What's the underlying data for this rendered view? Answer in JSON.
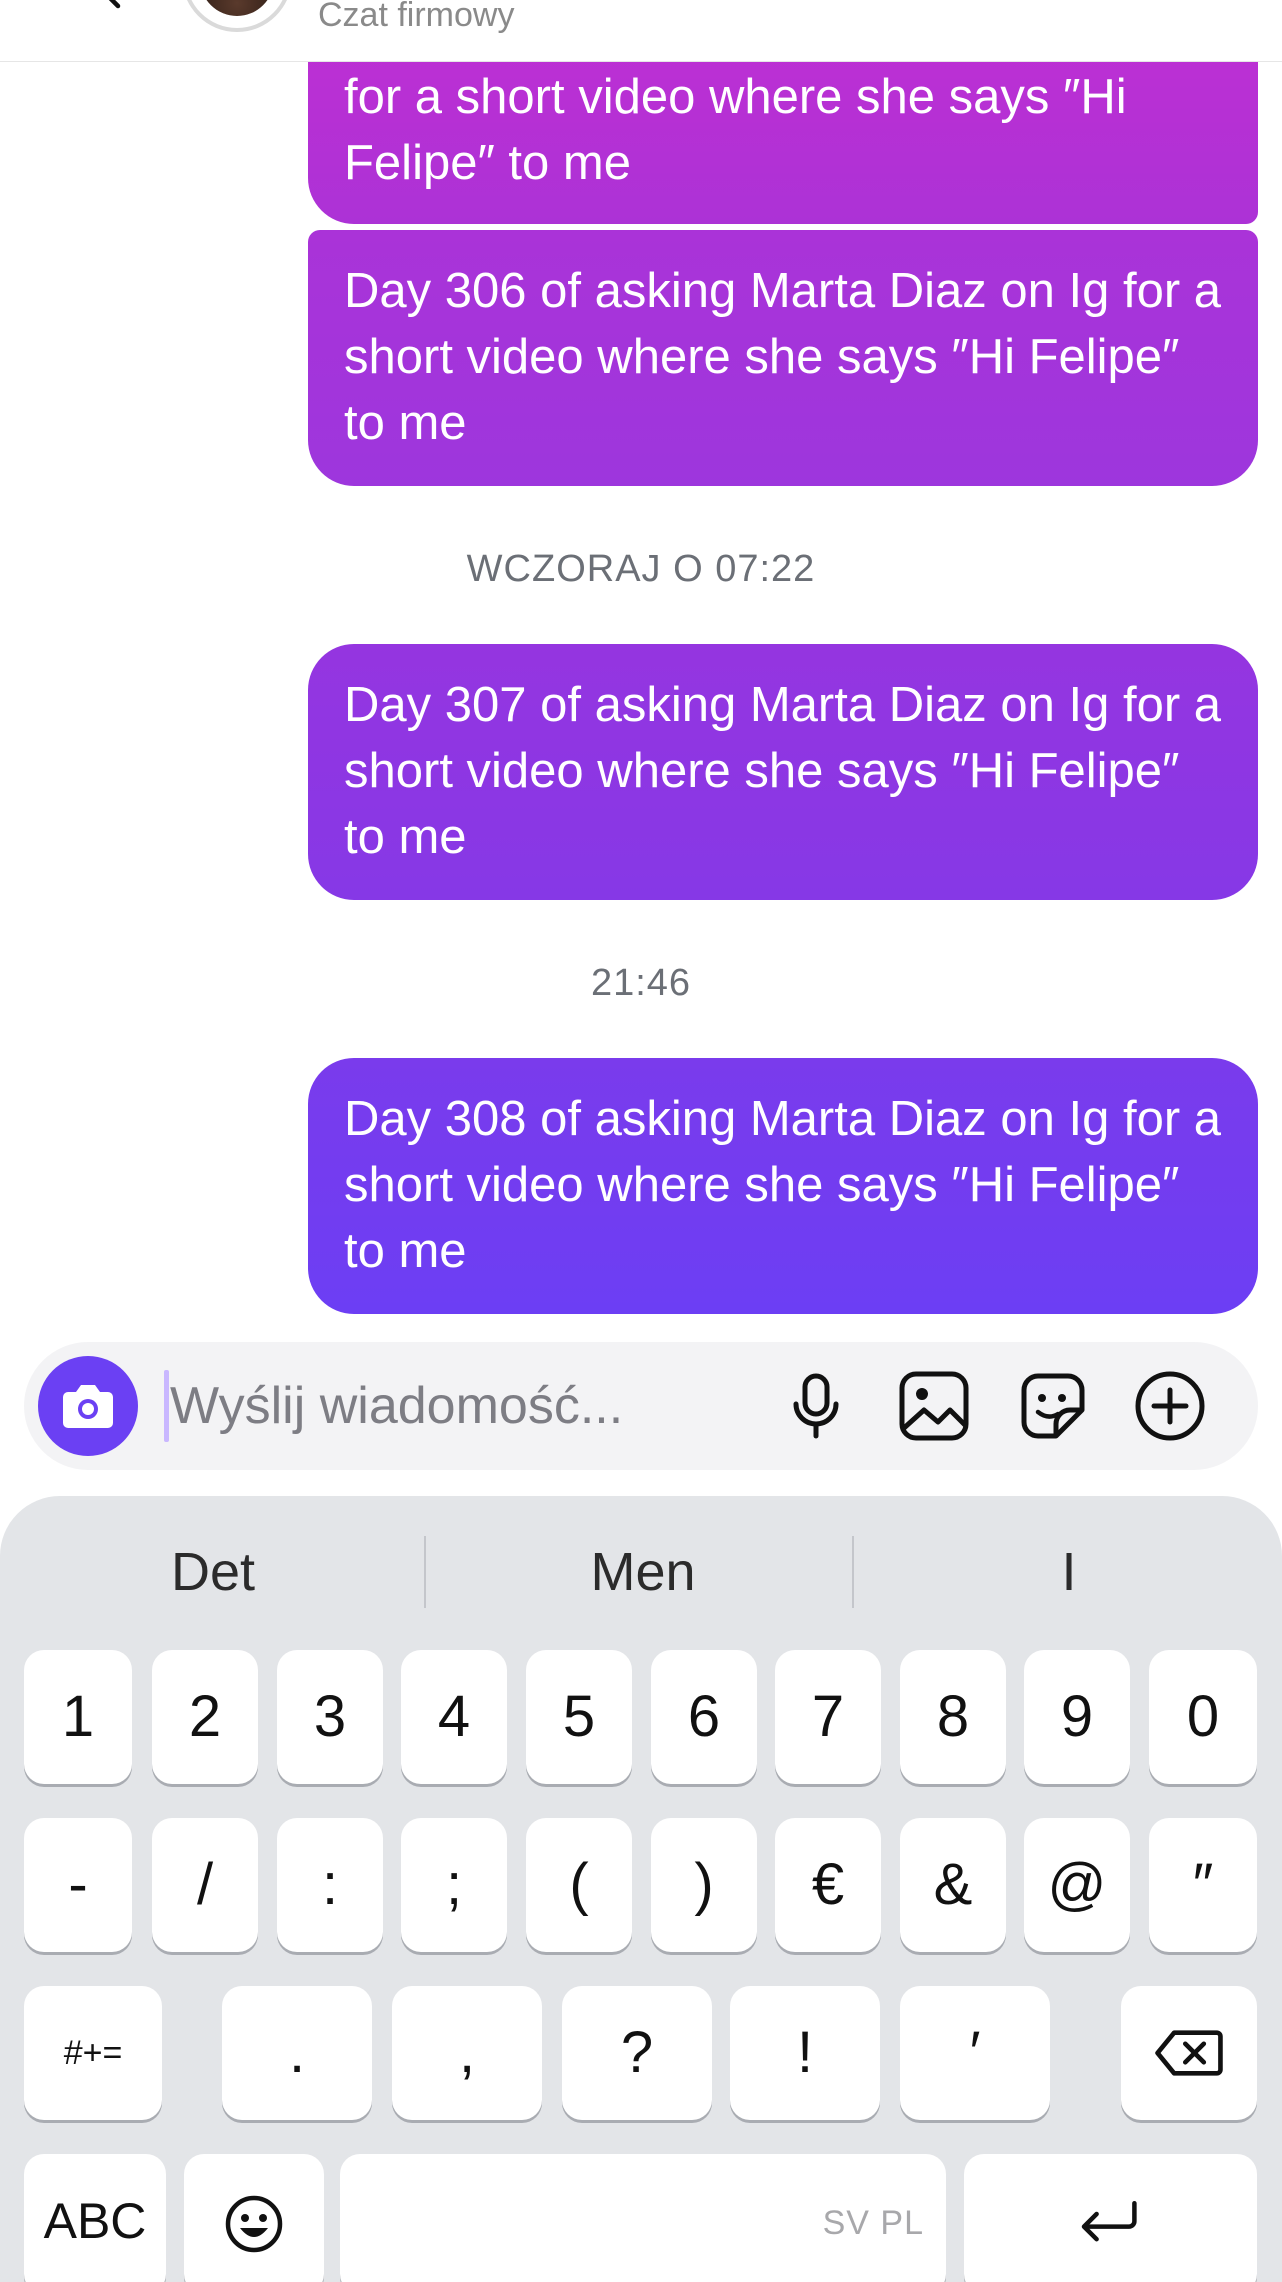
{
  "header": {
    "subtitle": "Czat firmowy"
  },
  "messages": [
    {
      "text": "for a short video where she says ″Hi Felipe″ to me"
    },
    {
      "text": "Day 306 of asking Marta Diaz on Ig for a short video where she says ″Hi Felipe″ to me"
    },
    {
      "text": "Day 307 of asking Marta Diaz on Ig for a short video where she says ″Hi Felipe″ to me"
    },
    {
      "text": "Day 308 of asking Marta Diaz on Ig for a short video where she says ″Hi Felipe″ to me"
    }
  ],
  "timestamps": [
    "WCZORAJ O 07:22",
    "21:46"
  ],
  "composer": {
    "placeholder": "Wyślij wiadomość...",
    "value": ""
  },
  "keyboard": {
    "suggestions": [
      "Det",
      "Men",
      "I"
    ],
    "row1": [
      "1",
      "2",
      "3",
      "4",
      "5",
      "6",
      "7",
      "8",
      "9",
      "0"
    ],
    "row2": [
      "-",
      "/",
      ":",
      ";",
      "(",
      ")",
      "€",
      "&",
      "@",
      "″"
    ],
    "row3": [
      ".",
      ",",
      "?",
      "!",
      "′"
    ],
    "mode_key": "#+=",
    "abc_key": "ABC",
    "space_hint": "SV PL"
  },
  "colors": {
    "bubble_top": "#bd2fd3",
    "bubble_bottom": "#6c3ef4",
    "camera_button": "#6b40f3",
    "keyboard_bg": "#e3e5e8"
  }
}
